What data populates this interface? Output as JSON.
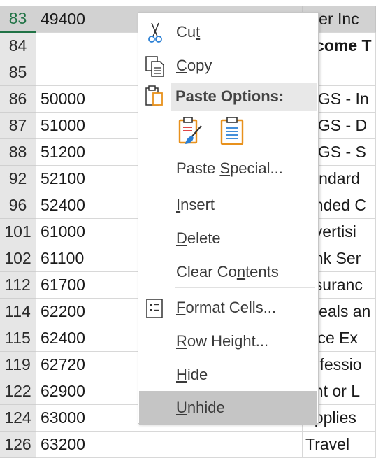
{
  "rows": [
    {
      "num": "83",
      "b": "49400",
      "c": "ther Inc",
      "selected": true
    },
    {
      "num": "84",
      "b": "",
      "c": "ncome T",
      "bold": true
    },
    {
      "num": "85",
      "b": "",
      "c": ""
    },
    {
      "num": "86",
      "b": "50000",
      "c": "OGS - In"
    },
    {
      "num": "87",
      "b": "51000",
      "c": "OGS - D"
    },
    {
      "num": "88",
      "b": "51200",
      "c": "OGS - S"
    },
    {
      "num": "92",
      "b": "52100",
      "c": "tandard"
    },
    {
      "num": "96",
      "b": "52400",
      "c": "anded C"
    },
    {
      "num": "101",
      "b": "61000",
      "c": "dvertisi"
    },
    {
      "num": "102",
      "b": "61100",
      "c": "ank Ser"
    },
    {
      "num": "112",
      "b": "61700",
      "c": "nsuranc"
    },
    {
      "num": "114",
      "b": "62200",
      "c": "Meals an"
    },
    {
      "num": "115",
      "b": "62400",
      "c": "ffice Ex"
    },
    {
      "num": "119",
      "b": "62720",
      "c": "rofessio"
    },
    {
      "num": "122",
      "b": "62900",
      "c": "ent or L"
    },
    {
      "num": "124",
      "b": "63000",
      "c": "upplies"
    },
    {
      "num": "126",
      "b": "63200",
      "c": "Travel"
    }
  ],
  "menu": {
    "cut": {
      "pre": "Cu",
      "key": "t",
      "post": ""
    },
    "copy": {
      "pre": "",
      "key": "C",
      "post": "opy"
    },
    "paste_options": "Paste Options:",
    "paste_special": {
      "pre": "Paste ",
      "key": "S",
      "post": "pecial..."
    },
    "insert": {
      "pre": "",
      "key": "I",
      "post": "nsert"
    },
    "delete": {
      "pre": "",
      "key": "D",
      "post": "elete"
    },
    "clear_contents": {
      "pre": "Clear Co",
      "key": "n",
      "post": "tents"
    },
    "format_cells": {
      "pre": "",
      "key": "F",
      "post": "ormat Cells..."
    },
    "row_height": {
      "pre": "",
      "key": "R",
      "post": "ow Height..."
    },
    "hide": {
      "pre": "",
      "key": "H",
      "post": "ide"
    },
    "unhide": {
      "pre": "",
      "key": "U",
      "post": "nhide"
    }
  },
  "colors": {
    "accent_green": "#217346",
    "paste_orange": "#e8911c",
    "paste_blue": "#2a7fd4"
  }
}
